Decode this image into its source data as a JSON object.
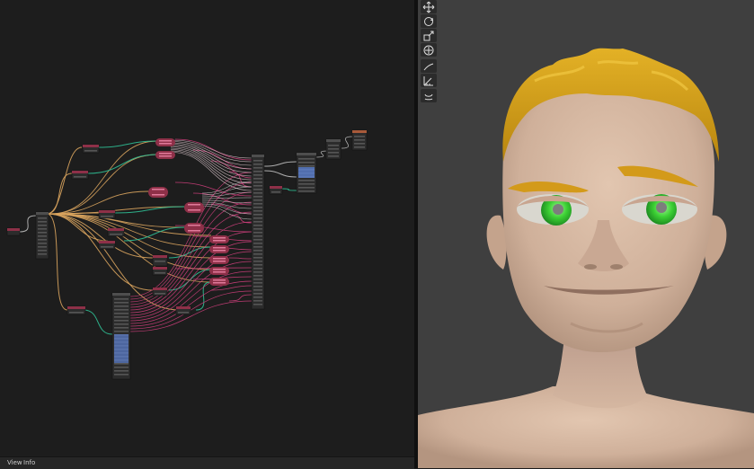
{
  "node_editor": {
    "menu": {
      "view_label": "View",
      "info_label": "Info"
    }
  },
  "viewport": {
    "tools": [
      {
        "icon": "move-icon"
      },
      {
        "icon": "rotate-icon"
      },
      {
        "icon": "scale-icon"
      },
      {
        "icon": "transform-icon"
      },
      {
        "icon": "annotate-icon"
      },
      {
        "icon": "measure-icon"
      },
      {
        "icon": "pose-tool-icon"
      }
    ],
    "object": {
      "hair_color": "#d4a018",
      "skin_color": "#d3b59e",
      "iris_color": "#3bcf33"
    }
  },
  "colors": {
    "link_orange": "#d9a45e",
    "link_teal": "#2fbf95",
    "link_magenta": "#cf3f7c",
    "link_gray": "#bfbfbf",
    "node_body": "#2c2c2c",
    "node_header_red": "#8e3048",
    "node_header_gray": "#4e4e4e",
    "socket_blue": "#5b7fd0"
  }
}
